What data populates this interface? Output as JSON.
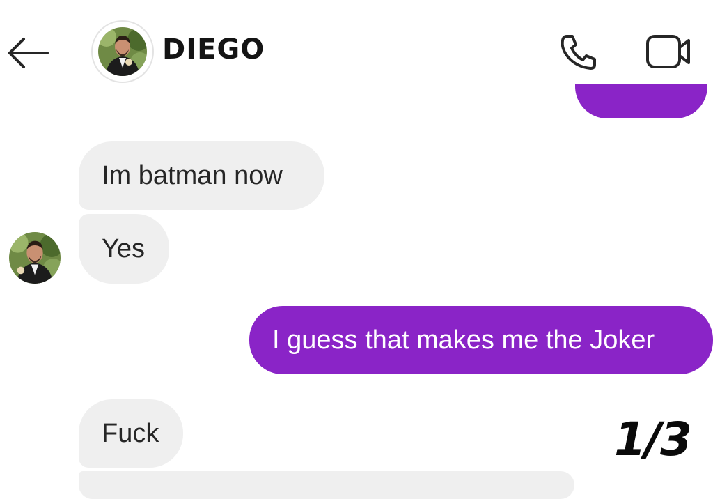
{
  "header": {
    "contact_name": "DIEGO",
    "back_icon": "arrow-left-icon",
    "call_icon": "phone-icon",
    "video_icon": "video-camera-icon"
  },
  "messages": [
    {
      "direction": "incoming",
      "text": "Im batman now"
    },
    {
      "direction": "incoming",
      "text": "Yes"
    },
    {
      "direction": "outgoing",
      "text": "I guess that makes me the Joker"
    },
    {
      "direction": "incoming",
      "text": "Fuck"
    }
  ],
  "overlay": {
    "page_indicator": "1/3"
  },
  "colors": {
    "outgoing_bubble": "#8a24c7",
    "incoming_bubble": "#efefef",
    "background": "#ffffff"
  }
}
